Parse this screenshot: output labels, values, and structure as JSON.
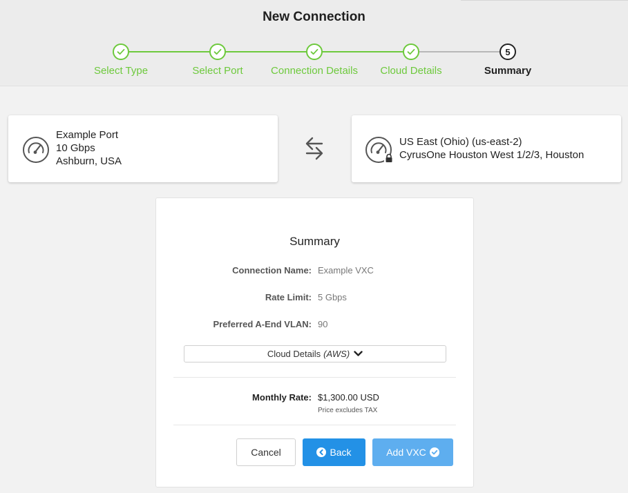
{
  "header": {
    "title": "New Connection",
    "steps": [
      {
        "label": "Select Type",
        "status": "complete"
      },
      {
        "label": "Select Port",
        "status": "complete"
      },
      {
        "label": "Connection Details",
        "status": "complete"
      },
      {
        "label": "Cloud Details",
        "status": "complete"
      },
      {
        "label": "Summary",
        "status": "current",
        "number": "5"
      }
    ]
  },
  "a_end": {
    "name": "Example Port",
    "speed": "10 Gbps",
    "location": "Ashburn, USA",
    "icon": "speedometer-icon"
  },
  "b_end": {
    "name": "US East (Ohio) (us-east-2)",
    "location": "CyrusOne Houston West 1/2/3, Houston",
    "icon": "speedometer-lock-icon"
  },
  "swap_icon": "swap-arrows-icon",
  "summary": {
    "title": "Summary",
    "rows": [
      {
        "label": "Connection Name:",
        "value": "Example VXC"
      },
      {
        "label": "Rate Limit:",
        "value": "5 Gbps"
      },
      {
        "label": "Preferred A-End VLAN:",
        "value": "90"
      }
    ],
    "cloud_details": {
      "label": "Cloud Details",
      "provider": "(AWS)"
    },
    "monthly_rate": {
      "label": "Monthly Rate:",
      "value": "$1,300.00 USD",
      "note": "Price excludes TAX"
    },
    "buttons": {
      "cancel": "Cancel",
      "back": "Back",
      "add": "Add VXC"
    }
  },
  "colors": {
    "accent_green": "#6dc93c",
    "primary_blue": "#2391e6",
    "light_blue": "#5eaeef"
  }
}
